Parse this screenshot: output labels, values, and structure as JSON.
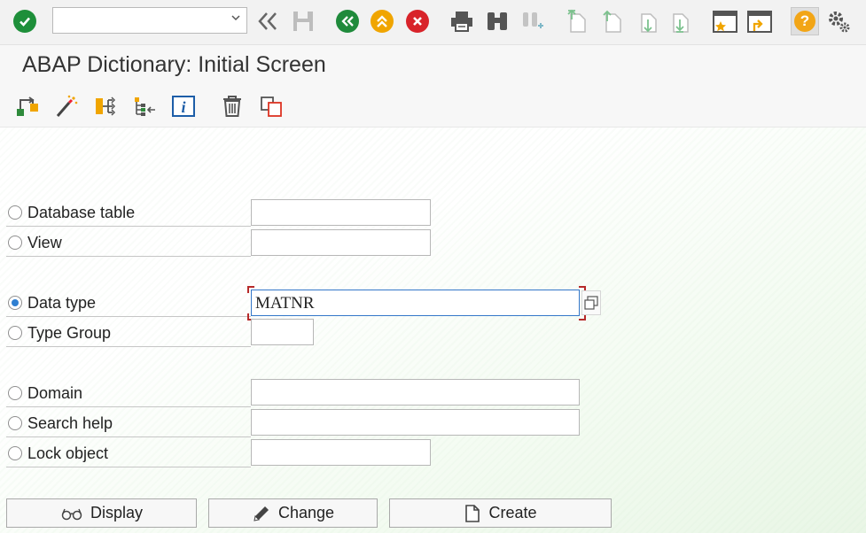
{
  "toolbar": {
    "command_field": {
      "value": "",
      "placeholder": ""
    }
  },
  "title": "ABAP Dictionary: Initial Screen",
  "options": [
    {
      "label": "Database table",
      "value": "",
      "selected": false
    },
    {
      "label": "View",
      "value": "",
      "selected": false
    },
    {
      "label": "Data type",
      "value": "MATNR",
      "selected": true
    },
    {
      "label": "Type Group",
      "value": "",
      "selected": false
    },
    {
      "label": "Domain",
      "value": "",
      "selected": false
    },
    {
      "label": "Search help",
      "value": "",
      "selected": false
    },
    {
      "label": "Lock object",
      "value": "",
      "selected": false
    }
  ],
  "buttons": {
    "display": "Display",
    "change": "Change",
    "create": "Create"
  },
  "colors": {
    "ok_green": "#1e8f3a",
    "nav_green": "#1f8a3b",
    "exit_orange": "#f0a500",
    "cancel_red": "#d8232a",
    "help_yellow": "#f2a516",
    "focus_blue": "#3477c9",
    "required_red": "#b62a2a"
  }
}
